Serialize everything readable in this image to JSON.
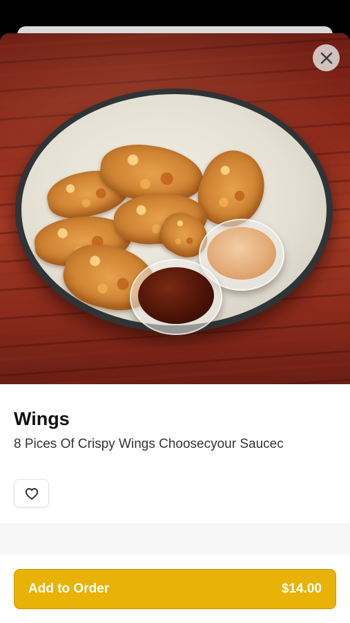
{
  "item": {
    "name": "Wings",
    "description": "8 Pices Of Crispy Wings Choosecyour Saucec",
    "image_alt": "Fried chicken wings with dipping sauces"
  },
  "icons": {
    "close": "close-icon",
    "favorite": "heart-outline-icon"
  },
  "order": {
    "label": "Add to Order",
    "price": "$14.00"
  },
  "colors": {
    "accent": "#e9b206",
    "title": "#111111",
    "text": "#333333",
    "background": "#000000"
  }
}
